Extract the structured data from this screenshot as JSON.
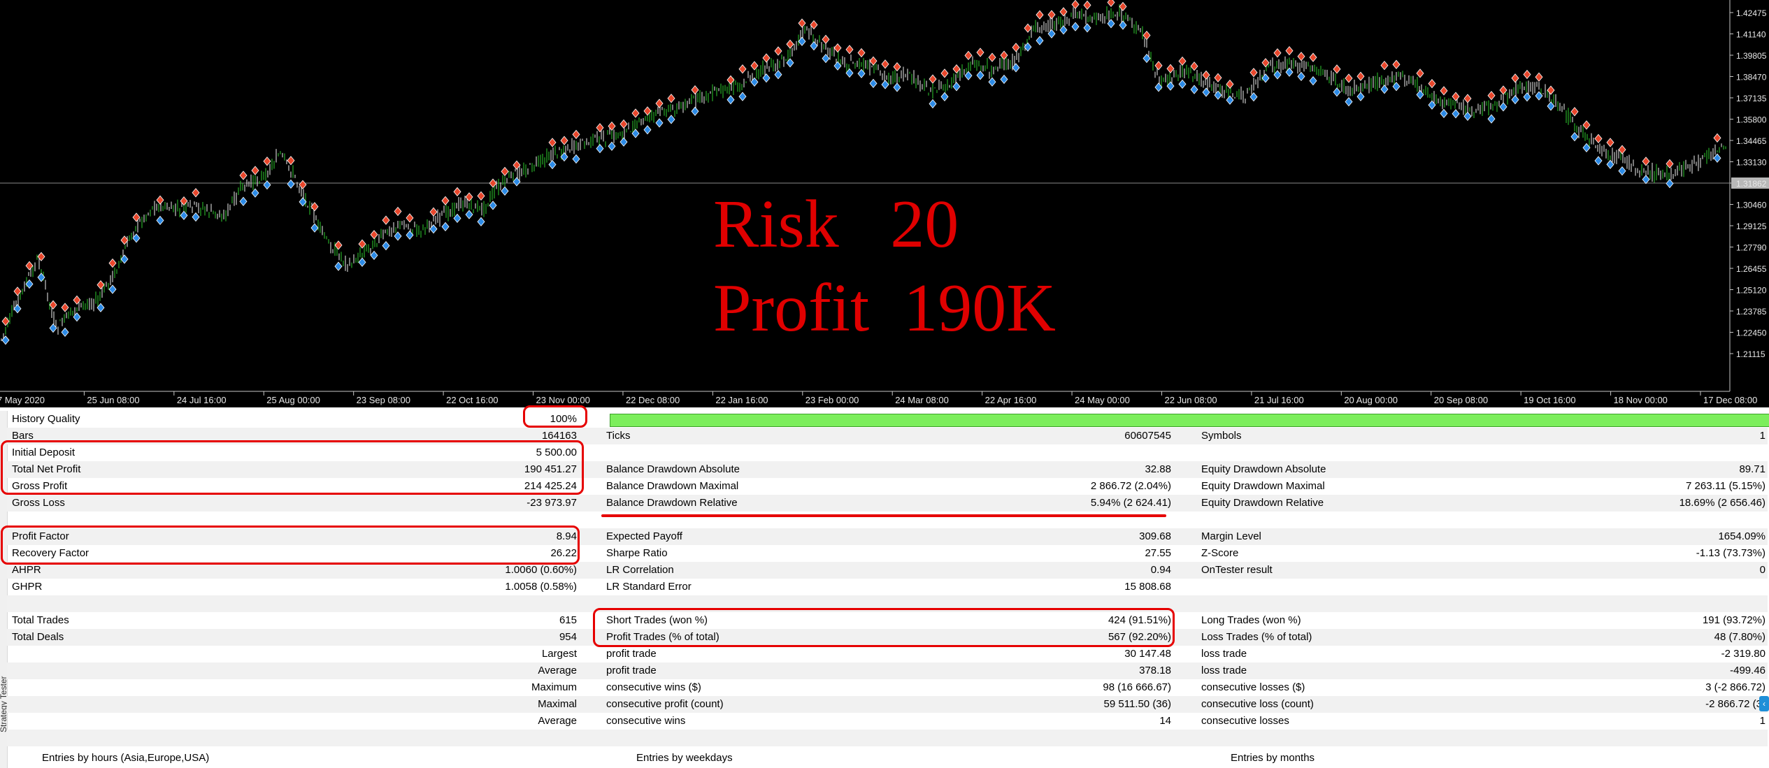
{
  "chart": {
    "price_labels": [
      "1.42475",
      "1.41140",
      "1.39805",
      "1.38470",
      "1.37135",
      "1.35800",
      "1.34465",
      "1.33130",
      "1.31862",
      "1.30460",
      "1.29125",
      "1.27790",
      "1.26455",
      "1.25120",
      "1.23785",
      "1.22450",
      "1.21115"
    ],
    "current_price": "1.31862",
    "date_labels": [
      "7 May 2020",
      "25 Jun 08:00",
      "24 Jul 16:00",
      "25 Aug 00:00",
      "23 Sep 08:00",
      "22 Oct 16:00",
      "23 Nov 00:00",
      "22 Dec 08:00",
      "22 Jan 16:00",
      "23 Feb 00:00",
      "24 Mar 08:00",
      "22 Apr 16:00",
      "24 May 00:00",
      "22 Jun 08:00",
      "21 Jul 16:00",
      "20 Aug 00:00",
      "20 Sep 08:00",
      "19 Oct 16:00",
      "18 Nov 00:00",
      "17 Dec 08:00"
    ],
    "overlay_risk": "Risk   20",
    "overlay_profit": "Profit  190K",
    "colors": {
      "background": "#000000",
      "candle_up": "#2ecc2e",
      "candle_down": "#f2f2f2",
      "sell_marker": "#e8472c",
      "buy_marker": "#2d8be6",
      "overlay": "#e00000"
    }
  },
  "report": {
    "history_quality": {
      "label": "History Quality",
      "value": "100%",
      "fill_fraction": 1.0
    },
    "bars": {
      "label": "Bars",
      "value": "164163"
    },
    "ticks": {
      "label": "Ticks",
      "value": "60607545"
    },
    "symbols": {
      "label": "Symbols",
      "value": "1"
    },
    "initial_deposit": {
      "label": "Initial Deposit",
      "value": "5 500.00"
    },
    "total_net_profit": {
      "label": "Total Net Profit",
      "value": "190 451.27"
    },
    "gross_profit": {
      "label": "Gross Profit",
      "value": "214 425.24"
    },
    "gross_loss": {
      "label": "Gross Loss",
      "value": "-23 973.97"
    },
    "balance_dd_abs": {
      "label": "Balance Drawdown Absolute",
      "value": "32.88"
    },
    "balance_dd_max": {
      "label": "Balance Drawdown Maximal",
      "value": "2 866.72 (2.04%)"
    },
    "balance_dd_rel": {
      "label": "Balance Drawdown Relative",
      "value": "5.94% (2 624.41)"
    },
    "equity_dd_abs": {
      "label": "Equity Drawdown Absolute",
      "value": "89.71"
    },
    "equity_dd_max": {
      "label": "Equity Drawdown Maximal",
      "value": "7 263.11 (5.15%)"
    },
    "equity_dd_rel": {
      "label": "Equity Drawdown Relative",
      "value": "18.69% (2 656.46)"
    },
    "profit_factor": {
      "label": "Profit Factor",
      "value": "8.94"
    },
    "recovery_factor": {
      "label": "Recovery Factor",
      "value": "26.22"
    },
    "ahpr": {
      "label": "AHPR",
      "value": "1.0060 (0.60%)"
    },
    "ghpr": {
      "label": "GHPR",
      "value": "1.0058 (0.58%)"
    },
    "expected_payoff": {
      "label": "Expected Payoff",
      "value": "309.68"
    },
    "sharpe_ratio": {
      "label": "Sharpe Ratio",
      "value": "27.55"
    },
    "lr_correlation": {
      "label": "LR Correlation",
      "value": "0.94"
    },
    "lr_std_error": {
      "label": "LR Standard Error",
      "value": "15 808.68"
    },
    "margin_level": {
      "label": "Margin Level",
      "value": "1654.09%"
    },
    "z_score": {
      "label": "Z-Score",
      "value": "-1.13 (73.73%)"
    },
    "ontester": {
      "label": "OnTester result",
      "value": "0"
    },
    "total_trades": {
      "label": "Total Trades",
      "value": "615"
    },
    "total_deals": {
      "label": "Total Deals",
      "value": "954"
    },
    "short_trades": {
      "label": "Short Trades (won %)",
      "value": "424 (91.51%)"
    },
    "profit_trades": {
      "label": "Profit Trades (% of total)",
      "value": "567 (92.20%)"
    },
    "long_trades": {
      "label": "Long Trades (won %)",
      "value": "191 (93.72%)"
    },
    "loss_trades": {
      "label": "Loss Trades (% of total)",
      "value": "48 (7.80%)"
    },
    "largest": {
      "prefix": "Largest",
      "profit_label": "profit trade",
      "profit_value": "30 147.48",
      "loss_label": "loss trade",
      "loss_value": "-2 319.80"
    },
    "average": {
      "prefix": "Average",
      "profit_label": "profit trade",
      "profit_value": "378.18",
      "loss_label": "loss trade",
      "loss_value": "-499.46"
    },
    "maximum": {
      "prefix": "Maximum",
      "profit_label": "consecutive wins ($)",
      "profit_value": "98 (16 666.67)",
      "loss_label": "consecutive losses ($)",
      "loss_value": "3 (-2 866.72)"
    },
    "maximal": {
      "prefix": "Maximal",
      "profit_label": "consecutive profit (count)",
      "profit_value": "59 511.50 (36)",
      "loss_label": "consecutive loss (count)",
      "loss_value": "-2 866.72 (3)"
    },
    "average_cons": {
      "prefix": "Average",
      "profit_label": "consecutive wins",
      "profit_value": "14",
      "loss_label": "consecutive losses",
      "loss_value": "1"
    },
    "sections": {
      "hours": "Entries by hours (Asia,Europe,USA)",
      "weekdays": "Entries by weekdays",
      "months": "Entries by months"
    },
    "side_label": "Strategy Tester"
  }
}
